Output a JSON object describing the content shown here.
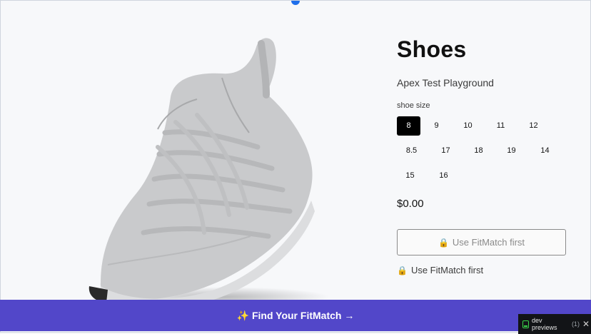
{
  "product": {
    "title": "Shoes",
    "vendor": "Apex Test Playground",
    "price": "$0.00",
    "image_alt": "grey knit sneaker"
  },
  "size_selector": {
    "label": "shoe size",
    "selected": "8",
    "options": [
      "8",
      "9",
      "10",
      "11",
      "12",
      "8.5",
      "17",
      "18",
      "19",
      "14",
      "15",
      "16"
    ]
  },
  "fitmatch_button": {
    "icon": "lock-icon",
    "label": "Use FitMatch first"
  },
  "fitmatch_note": {
    "icon": "lock-icon",
    "text": "Use FitMatch first"
  },
  "banner": {
    "label": "✨ Find Your FitMatch →"
  },
  "dev_badge": {
    "icon": "preview-icon",
    "label": "dev previews",
    "count": "(1)",
    "close": "✕"
  },
  "colors": {
    "accent": "#5247c9",
    "selected_size": "#000000",
    "link_dot": "#1f6feb"
  }
}
